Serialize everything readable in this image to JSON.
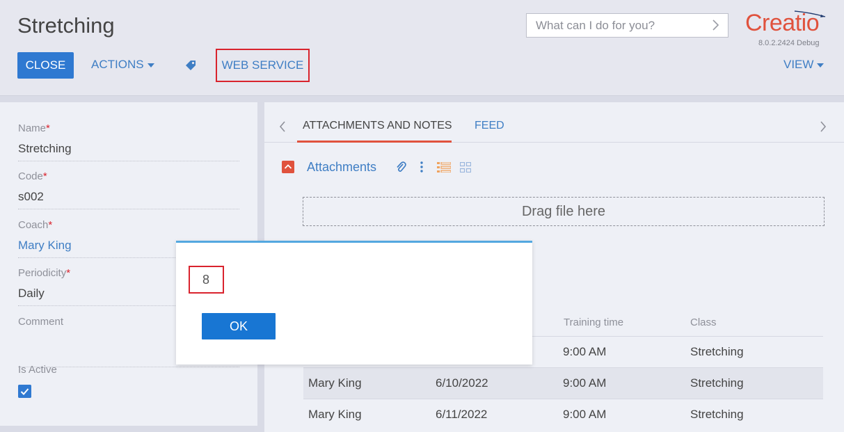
{
  "header": {
    "title": "Stretching",
    "close_label": "CLOSE",
    "actions_label": "ACTIONS",
    "webservice_label": "WEB SERVICE",
    "view_label": "VIEW",
    "search_placeholder": "What can I do for you?",
    "logo_text": "Creatio",
    "version": "8.0.2.2424 Debug"
  },
  "form": {
    "name_label": "Name",
    "name_value": "Stretching",
    "code_label": "Code",
    "code_value": "s002",
    "coach_label": "Coach",
    "coach_value": "Mary King",
    "periodicity_label": "Periodicity",
    "periodicity_value": "Daily",
    "comment_label": "Comment",
    "comment_value": "",
    "active_label": "Is Active",
    "is_active": true,
    "required_mark": "*"
  },
  "tabs": {
    "attachments_label": "ATTACHMENTS AND NOTES",
    "feed_label": "FEED"
  },
  "attachments": {
    "title": "Attachments",
    "dropzone_text": "Drag file here"
  },
  "schedule": {
    "columns": [
      "Training time",
      "Class"
    ],
    "rows": [
      {
        "coach": "",
        "date": "",
        "time": "9:00 AM",
        "class": "Stretching"
      },
      {
        "coach": "Mary King",
        "date": "6/10/2022",
        "time": "9:00 AM",
        "class": "Stretching"
      },
      {
        "coach": "Mary King",
        "date": "6/11/2022",
        "time": "9:00 AM",
        "class": "Stretching"
      }
    ]
  },
  "dialog": {
    "message": "8",
    "ok_label": "OK"
  },
  "colors": {
    "accent": "#2f79d1",
    "brand": "#e0523d",
    "highlight": "#d9232d"
  }
}
